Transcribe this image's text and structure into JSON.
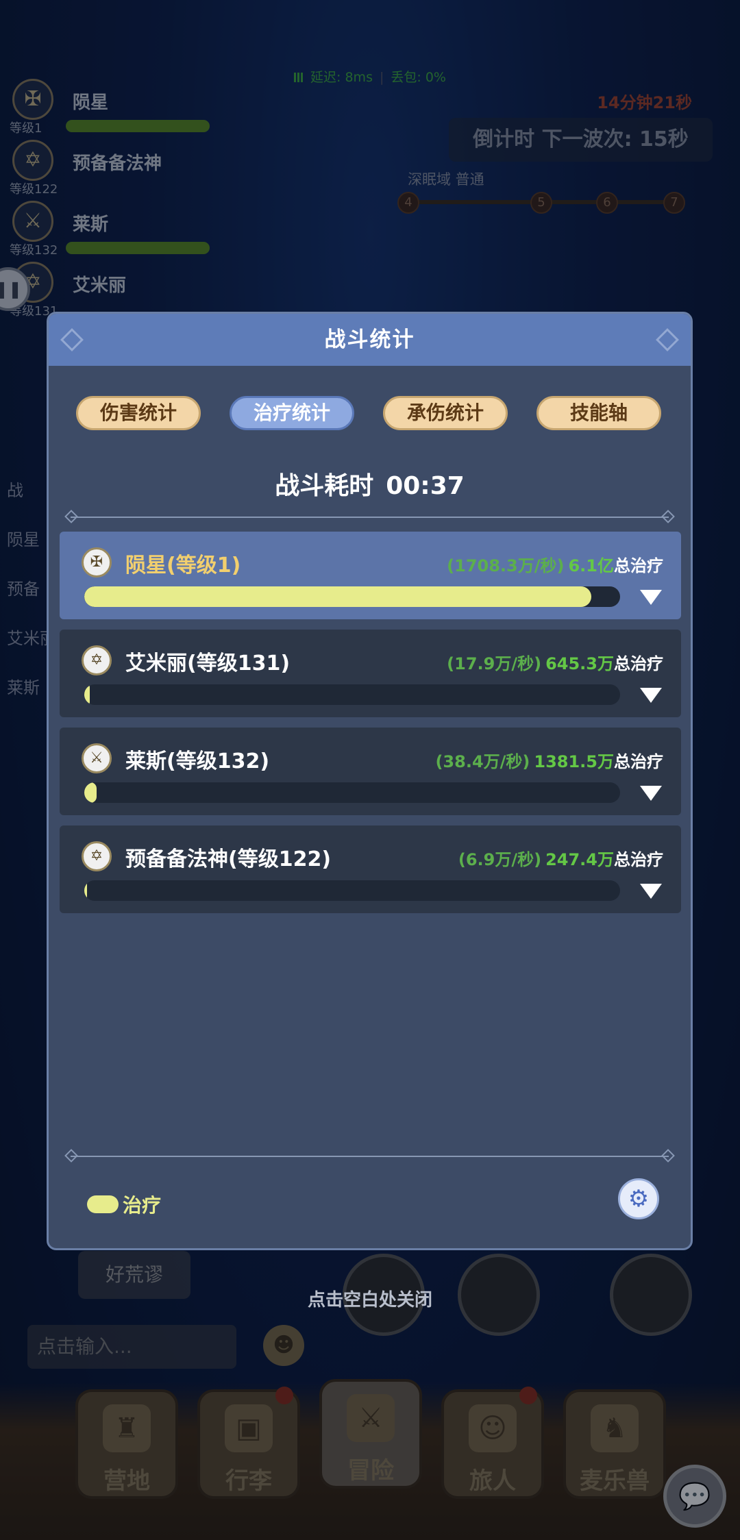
{
  "network": {
    "latency": "延迟: 8ms",
    "packet_loss": "丢包: 0%"
  },
  "hud": {
    "party": [
      {
        "name": "陨星",
        "level": "等级1",
        "hp": 1.0
      },
      {
        "name": "预备备法神",
        "level": "等级122",
        "hp": 0.0
      },
      {
        "name": "莱斯",
        "level": "等级132",
        "hp": 1.0
      },
      {
        "name": "艾米丽",
        "level": "等级131",
        "hp": 0.4
      }
    ],
    "elapsed": "14分钟21秒",
    "wave_countdown": "倒计时 下一波次: 15秒",
    "zone": "深眠域 普通",
    "stages": [
      "4",
      "5",
      "6",
      "7"
    ],
    "pause_icon": "pause-icon"
  },
  "side_list": [
    "战",
    "陨星",
    "预备",
    "艾米丽",
    "莱斯"
  ],
  "modal": {
    "title": "战斗统计",
    "tabs": [
      {
        "label": "伤害统计",
        "active": false
      },
      {
        "label": "治疗统计",
        "active": true
      },
      {
        "label": "承伤统计",
        "active": false
      },
      {
        "label": "技能轴",
        "active": false
      }
    ],
    "duration_label": "战斗耗时",
    "duration_value": "00:37",
    "rows": [
      {
        "name": "陨星(等级1)",
        "rate": "(1708.3万/秒)",
        "total": "6.1亿",
        "suffix": "总治疗",
        "fraction": 0.946,
        "icon": "cross-emblem-icon"
      },
      {
        "name": "艾米丽(等级131)",
        "rate": "(17.9万/秒)",
        "total": "645.3万",
        "suffix": "总治疗",
        "fraction": 0.0106,
        "icon": "hexagram-emblem-icon"
      },
      {
        "name": "莱斯(等级132)",
        "rate": "(38.4万/秒)",
        "total": "1381.5万",
        "suffix": "总治疗",
        "fraction": 0.0226,
        "icon": "sword-emblem-icon"
      },
      {
        "name": "预备备法神(等级122)",
        "rate": "(6.9万/秒)",
        "total": "247.4万",
        "suffix": "总治疗",
        "fraction": 0.004,
        "icon": "hexagram-emblem-icon"
      }
    ],
    "legend_label": "治疗",
    "settings_icon": "gear-icon",
    "colors": {
      "heal_bar": "#e7ec8c",
      "active_tab": "#8ea9e0",
      "tab": "#f3d6a8",
      "header": "#5e7cb8"
    }
  },
  "close_hint": "点击空白处关闭",
  "chat": {
    "bubble": "好荒谬",
    "input_placeholder": "点击输入..."
  },
  "bottom_nav": [
    {
      "label": "营地",
      "badge": false
    },
    {
      "label": "行李",
      "badge": true
    },
    {
      "label": "冒险",
      "badge": false,
      "active": true
    },
    {
      "label": "旅人",
      "badge": true
    },
    {
      "label": "麦乐兽",
      "badge": false
    }
  ]
}
